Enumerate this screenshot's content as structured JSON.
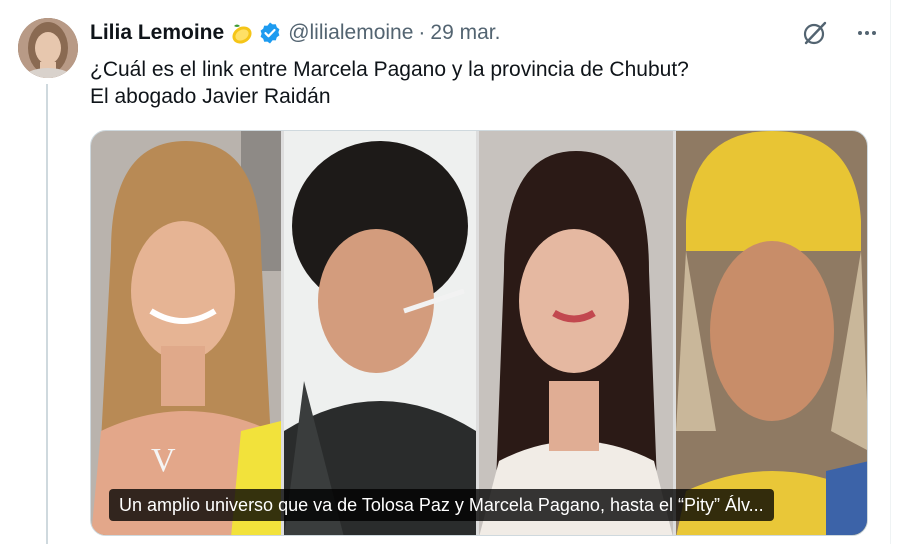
{
  "author": {
    "display_name": "Lilia Lemoine",
    "emoji_icon": "lemon-icon",
    "badge_icon": "verified-badge-icon",
    "handle": "@lilialemoine",
    "separator": "·",
    "date": "29 mar."
  },
  "actions": {
    "grok_icon": "grok-icon",
    "more_icon": "more-icon"
  },
  "tweet": {
    "line1": "¿Cuál es el link entre Marcela Pagano y la provincia de Chubut?",
    "line2": "El abogado Javier Raidán"
  },
  "media": {
    "caption": "Un amplio universo que va de Tolosa Paz y Marcela Pagano, hasta el “Pity” Álv..."
  },
  "colors": {
    "verified": "#1d9bf0",
    "secondary_text": "#536471"
  }
}
